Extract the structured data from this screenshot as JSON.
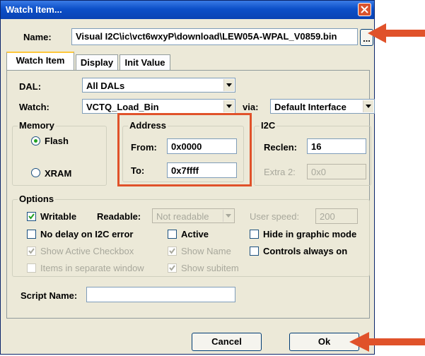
{
  "window": {
    "title": "Watch Item..."
  },
  "name_row": {
    "label": "Name:",
    "value": "Visual I2C\\ic\\vct6wxyP\\download\\LEW05A-WPAL_V0859.bin",
    "browse_label": "..."
  },
  "tabs": [
    {
      "label": "Watch Item",
      "active": true
    },
    {
      "label": "Display",
      "active": false
    },
    {
      "label": "Init Value",
      "active": false
    }
  ],
  "dal": {
    "label": "DAL:",
    "value": "All DALs"
  },
  "watch": {
    "label": "Watch:",
    "value": "VCTQ_Load_Bin",
    "via_label": "via:",
    "via_value": "Default Interface"
  },
  "memory": {
    "legend": "Memory",
    "flash_label": "Flash",
    "xram_label": "XRAM",
    "selected": "Flash"
  },
  "address": {
    "legend": "Address",
    "from_label": "From:",
    "from_value": "0x0000",
    "to_label": "To:",
    "to_value": "0x7ffff"
  },
  "i2c": {
    "legend": "I2C",
    "reclen_label": "Reclen:",
    "reclen_value": "16",
    "extra2_label": "Extra 2:",
    "extra2_value": "0x0"
  },
  "options": {
    "legend": "Options",
    "writable": {
      "label": "Writable",
      "checked": true
    },
    "readable_label": "Readable:",
    "readable_value": "Not readable",
    "user_speed_label": "User speed:",
    "user_speed_value": "200",
    "no_delay": {
      "label": "No delay on I2C error",
      "checked": false
    },
    "active": {
      "label": "Active",
      "checked": false
    },
    "hide_graphic": {
      "label": "Hide in graphic mode",
      "checked": false
    },
    "show_active_checkbox": {
      "label": "Show Active Checkbox",
      "checked": true
    },
    "show_name": {
      "label": "Show Name",
      "checked": true
    },
    "controls_always_on": {
      "label": "Controls always on",
      "checked": false
    },
    "items_separate": {
      "label": "Items in separate window",
      "checked": false
    },
    "show_subitem": {
      "label": "Show subitem",
      "checked": true
    }
  },
  "script": {
    "label": "Script Name:",
    "value": ""
  },
  "buttons": {
    "cancel": "Cancel",
    "ok": "Ok"
  },
  "colors": {
    "title_bar": "#0c4fc8",
    "annotation": "#e0522a",
    "dialog_bg": "#ece9d8"
  }
}
